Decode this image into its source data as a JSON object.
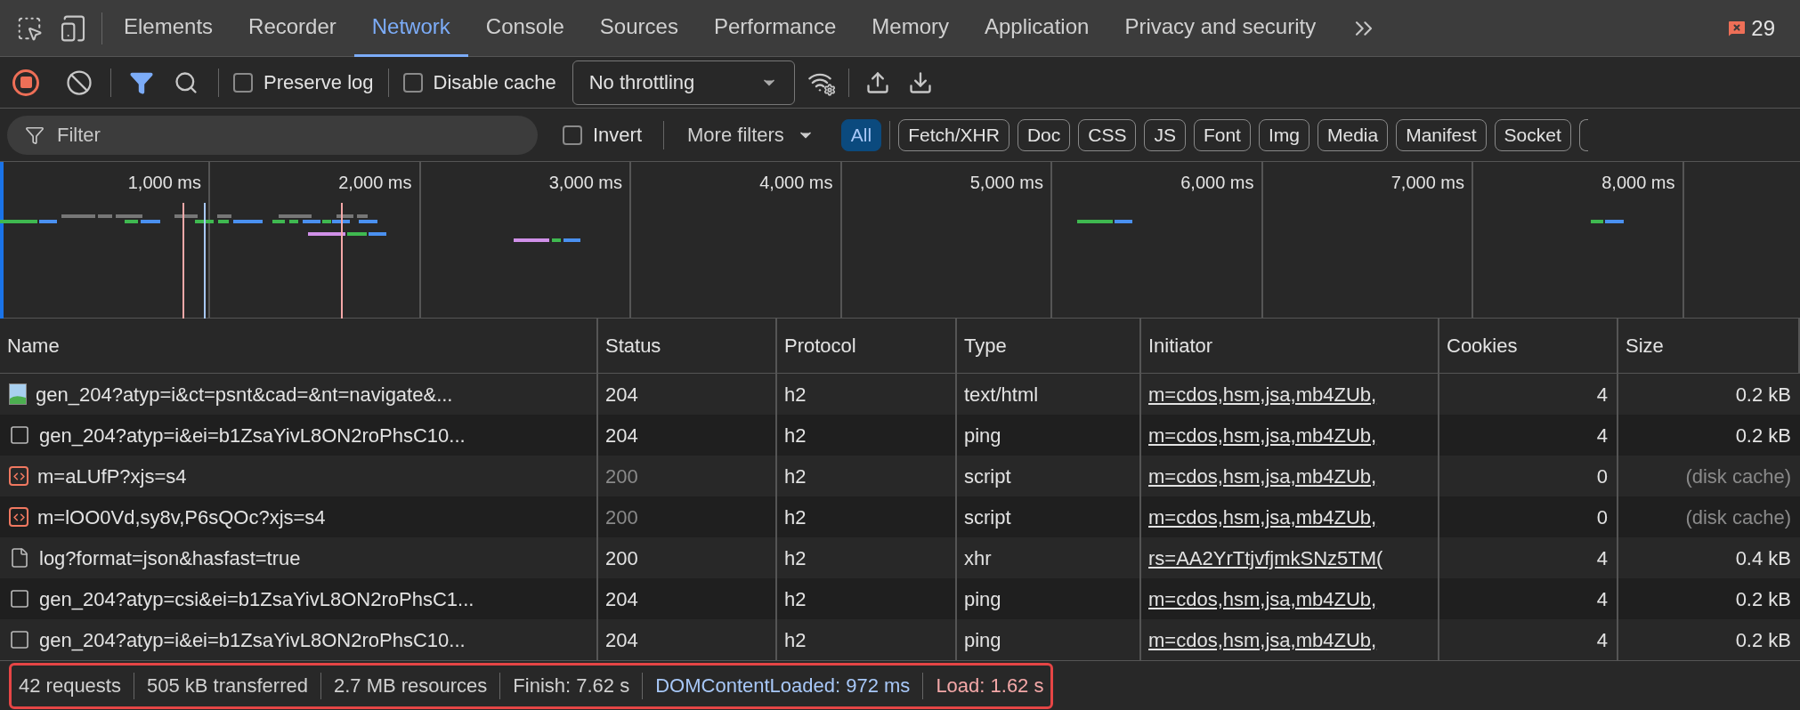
{
  "tabs": [
    {
      "label": "Elements",
      "selected": false
    },
    {
      "label": "Recorder",
      "selected": false
    },
    {
      "label": "Network",
      "selected": true
    },
    {
      "label": "Console",
      "selected": false
    },
    {
      "label": "Sources",
      "selected": false
    },
    {
      "label": "Performance",
      "selected": false
    },
    {
      "label": "Memory",
      "selected": false
    },
    {
      "label": "Application",
      "selected": false
    },
    {
      "label": "Privacy and security",
      "selected": false
    }
  ],
  "issues_count": "29",
  "toolbar": {
    "recording": true,
    "filter_active": true,
    "preserve_log": {
      "label": "Preserve log",
      "checked": false
    },
    "disable_cache": {
      "label": "Disable cache",
      "checked": false
    },
    "throttling": "No throttling"
  },
  "filter_bar": {
    "placeholder": "Filter",
    "invert": {
      "label": "Invert",
      "checked": false
    },
    "more_filters": "More filters",
    "types": [
      {
        "label": "All",
        "selected": true
      },
      {
        "label": "Fetch/XHR",
        "selected": false
      },
      {
        "label": "Doc",
        "selected": false
      },
      {
        "label": "CSS",
        "selected": false
      },
      {
        "label": "JS",
        "selected": false
      },
      {
        "label": "Font",
        "selected": false
      },
      {
        "label": "Img",
        "selected": false
      },
      {
        "label": "Media",
        "selected": false
      },
      {
        "label": "Manifest",
        "selected": false
      },
      {
        "label": "Socket",
        "selected": false
      }
    ]
  },
  "overview": {
    "ticks": [
      "1,000 ms",
      "2,000 ms",
      "3,000 ms",
      "4,000 ms",
      "5,000 ms",
      "6,000 ms",
      "7,000 ms",
      "8,000 ms"
    ]
  },
  "table": {
    "columns": [
      "Name",
      "Status",
      "Protocol",
      "Type",
      "Initiator",
      "Cookies",
      "Size"
    ],
    "rows": [
      {
        "kind": "image",
        "name": "gen_204?atyp=i&ct=psnt&cad=&nt=navigate&...",
        "status": "204",
        "protocol": "h2",
        "type": "text/html",
        "initiator": "m=cdos,hsm,jsa,mb4ZUb,",
        "cookies": "4",
        "size": "0.2 kB",
        "cached": false
      },
      {
        "kind": "blank",
        "name": "gen_204?atyp=i&ei=b1ZsaYivL8ON2roPhsC10...",
        "status": "204",
        "protocol": "h2",
        "type": "ping",
        "initiator": "m=cdos,hsm,jsa,mb4ZUb,",
        "cookies": "4",
        "size": "0.2 kB",
        "cached": false
      },
      {
        "kind": "script",
        "name": "m=aLUfP?xjs=s4",
        "status": "200",
        "protocol": "h2",
        "type": "script",
        "initiator": "m=cdos,hsm,jsa,mb4ZUb,",
        "cookies": "0",
        "size": "(disk cache)",
        "cached": true
      },
      {
        "kind": "script",
        "name": "m=lOO0Vd,sy8v,P6sQOc?xjs=s4",
        "status": "200",
        "protocol": "h2",
        "type": "script",
        "initiator": "m=cdos,hsm,jsa,mb4ZUb,",
        "cookies": "0",
        "size": "(disk cache)",
        "cached": true
      },
      {
        "kind": "document",
        "name": "log?format=json&hasfast=true",
        "status": "200",
        "protocol": "h2",
        "type": "xhr",
        "initiator": "rs=AA2YrTtjvfjmkSNz5TM(",
        "cookies": "4",
        "size": "0.4 kB",
        "cached": false
      },
      {
        "kind": "blank",
        "name": "gen_204?atyp=csi&ei=b1ZsaYivL8ON2roPhsC1...",
        "status": "204",
        "protocol": "h2",
        "type": "ping",
        "initiator": "m=cdos,hsm,jsa,mb4ZUb,",
        "cookies": "4",
        "size": "0.2 kB",
        "cached": false
      },
      {
        "kind": "blank",
        "name": "gen_204?atyp=i&ei=b1ZsaYivL8ON2roPhsC10...",
        "status": "204",
        "protocol": "h2",
        "type": "ping",
        "initiator": "m=cdos,hsm,jsa,mb4ZUb,",
        "cookies": "4",
        "size": "0.2 kB",
        "cached": false
      }
    ]
  },
  "status_bar": {
    "highlighted": true,
    "items": [
      {
        "kind": "plain",
        "text": "42 requests"
      },
      {
        "kind": "plain",
        "text": "505 kB transferred"
      },
      {
        "kind": "plain",
        "text": "2.7 MB resources"
      },
      {
        "kind": "plain",
        "text": "Finish: 7.62 s"
      },
      {
        "kind": "dom",
        "text": "DOMContentLoaded: 972 ms"
      },
      {
        "kind": "load",
        "text": "Load: 1.62 s"
      }
    ]
  }
}
